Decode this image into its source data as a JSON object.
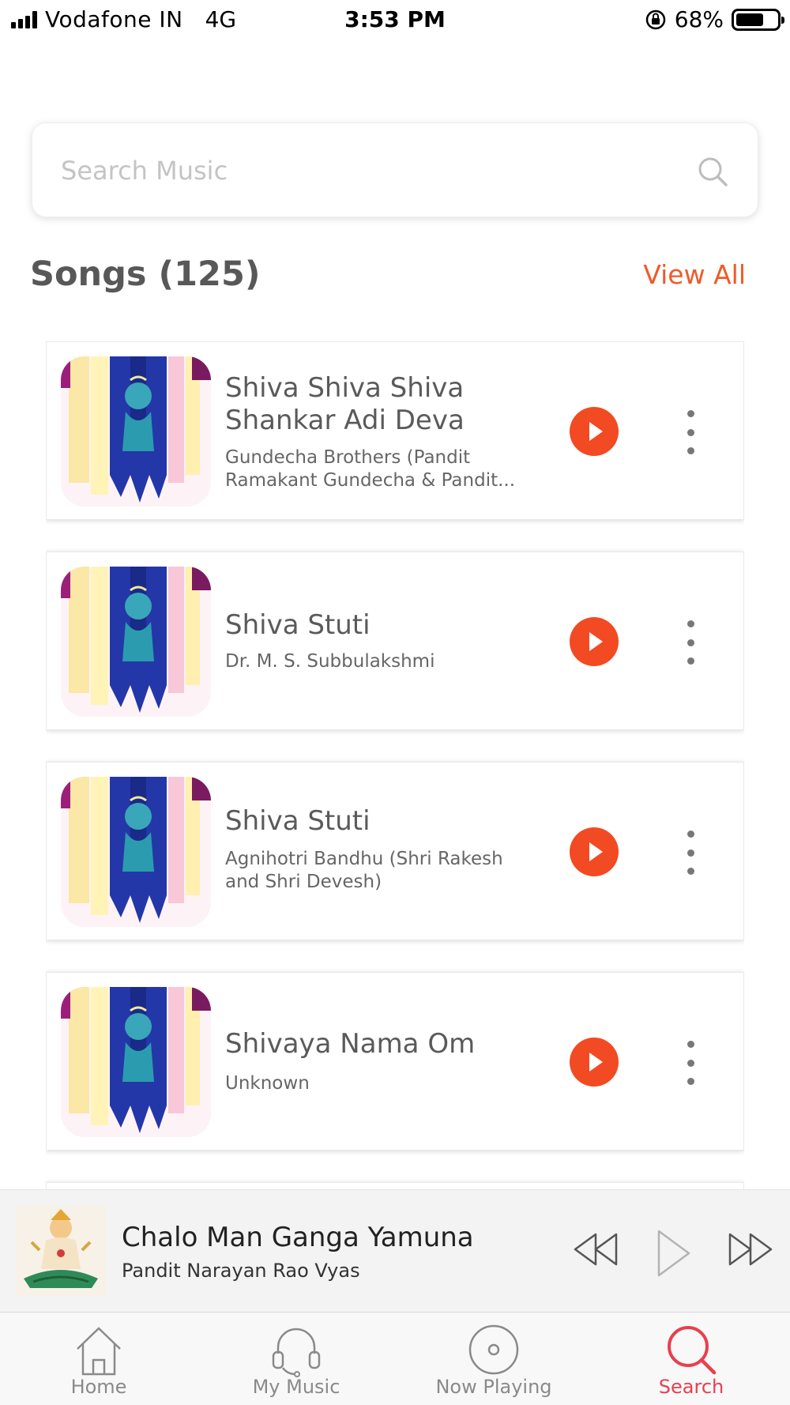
{
  "status_bar": {
    "carrier": "Vodafone IN",
    "network": "4G",
    "time": "3:53 PM",
    "battery": "68%",
    "battery_level": 0.68
  },
  "search": {
    "placeholder": "Search Music",
    "value": ""
  },
  "section": {
    "title": "Songs (125)",
    "view_all": "View All"
  },
  "songs": [
    {
      "title": "Shiva Shiva Shiva Shankar Adi Deva",
      "artist": "Gundecha Brothers (Pandit Ramakant Gundecha & Pandit..."
    },
    {
      "title": "Shiva Stuti",
      "artist": "Dr. M. S. Subbulakshmi"
    },
    {
      "title": "Shiva Stuti",
      "artist": "Agnihotri Bandhu (Shri Rakesh and Shri Devesh)"
    },
    {
      "title": "Shivaya Nama Om",
      "artist": "Unknown"
    }
  ],
  "now_playing": {
    "title": "Chalo Man Ganga Yamuna",
    "artist": "Pandit Narayan Rao Vyas"
  },
  "tabs": [
    {
      "label": "Home",
      "icon": "home-icon",
      "active": false
    },
    {
      "label": "My Music",
      "icon": "headphones-icon",
      "active": false
    },
    {
      "label": "Now Playing",
      "icon": "disc-icon",
      "active": false
    },
    {
      "label": "Search",
      "icon": "search-icon",
      "active": true
    }
  ],
  "colors": {
    "accent": "#f05a28",
    "play_button": "#f24a22",
    "active_tab": "#e8404e"
  }
}
